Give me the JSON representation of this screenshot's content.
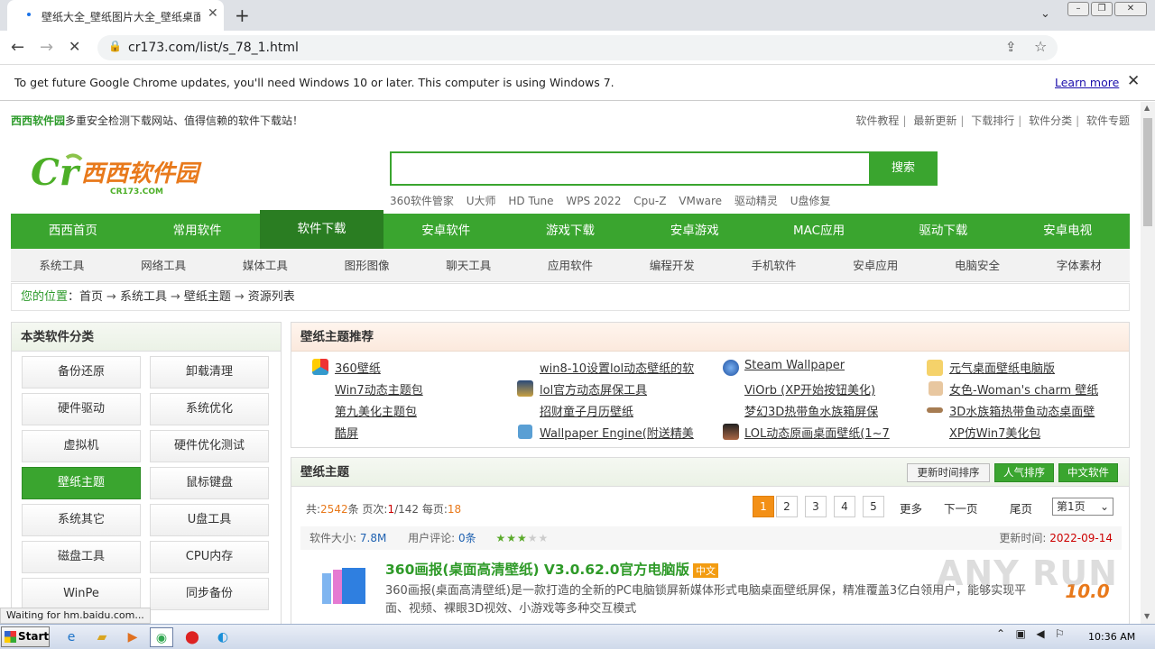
{
  "browser": {
    "tab_title": "壁纸大全_壁纸图片大全_壁纸桌面下载",
    "url": "cr173.com/list/s_78_1.html",
    "infobar_message": "To get future Google Chrome updates, you'll need Windows 10 or later. This computer is using Windows 7.",
    "infobar_link": "Learn more",
    "status_text": "Waiting for hm.baidu.com..."
  },
  "site": {
    "brand": "西西软件园",
    "tagline": "多重安全检测下载网站、值得信赖的软件下载站！",
    "top_links": [
      "软件教程",
      "最新更新",
      "下载排行",
      "软件分类",
      "软件专题"
    ],
    "logo_text": "西西软件园",
    "logo_sub": "CR173.COM",
    "search_button": "搜索",
    "hot_words": [
      "360软件管家",
      "U大师",
      "HD Tune",
      "WPS 2022",
      "Cpu-Z",
      "VMware",
      "驱动精灵",
      "U盘修复"
    ],
    "main_nav": [
      "西西首页",
      "常用软件",
      "软件下载",
      "安卓软件",
      "游戏下载",
      "安卓游戏",
      "MAC应用",
      "驱动下载",
      "安卓电视"
    ],
    "main_nav_active": "软件下载",
    "sub_nav": [
      "系统工具",
      "网络工具",
      "媒体工具",
      "图形图像",
      "聊天工具",
      "应用软件",
      "编程开发",
      "手机软件",
      "安卓应用",
      "电脑安全",
      "字体素材"
    ],
    "breadcrumb": {
      "label": "您的位置",
      "items": [
        "首页",
        "系统工具",
        "壁纸主题",
        "资源列表"
      ]
    }
  },
  "categories": {
    "title": "本类软件分类",
    "items": [
      "备份还原",
      "卸载清理",
      "硬件驱动",
      "系统优化",
      "虚拟机",
      "硬件优化测试",
      "壁纸主题",
      "鼠标键盘",
      "系统其它",
      "U盘工具",
      "磁盘工具",
      "CPU内存",
      "WinPe",
      "同步备份"
    ],
    "active": "壁纸主题"
  },
  "recommend": {
    "title": "壁纸主题推荐",
    "col1": [
      "360壁纸",
      "Win7动态主题包",
      "第九美化主题包",
      "酷屏"
    ],
    "col2": [
      "win8-10设置lol动态壁纸的软",
      "lol官方动态屏保工具",
      "招财童子月历壁纸",
      "Wallpaper Engine(附送精美"
    ],
    "col3": [
      "Steam Wallpaper",
      "ViOrb (XP开始按钮美化)",
      "梦幻3D热带鱼水族箱屏保",
      "LOL动态原画桌面壁纸(1~7"
    ],
    "col4": [
      "元气桌面壁纸电脑版",
      "女色-Woman's charm 壁纸",
      "3D水族箱热带鱼动态桌面壁",
      "XP仿Win7美化包"
    ]
  },
  "listing": {
    "title": "壁纸主题",
    "sort_buttons": [
      "更新时间排序",
      "人气排序",
      "中文软件"
    ],
    "total_prefix": "共:",
    "total": "2542",
    "total_suffix": "条 页次:",
    "page_cur": "1",
    "page_sep": "/142 每页:",
    "per_page": "18",
    "pages": [
      "1",
      "2",
      "3",
      "4",
      "5"
    ],
    "more": "更多",
    "next": "下一页",
    "last": "尾页",
    "page_select": "第1页",
    "item": {
      "size_label": "软件大小:",
      "size": "7.8M",
      "comment_label": "用户评论:",
      "comments": "0条",
      "rating": 3,
      "update_label": "更新时间:",
      "update": "2022-09-14",
      "title": "360画报(桌面高清壁纸) V3.0.62.0官方电脑版",
      "lang_badge": "中文",
      "desc": "360画报(桌面高清壁纸)是一款打造的全新的PC电脑锁屏新媒体形式电脑桌面壁纸屏保，精准覆盖3亿白领用户，能够实现平面、视频、裸眼3D视效、小游戏等多种交互模式",
      "score": "10.0"
    }
  },
  "watermark": "ANY RUN",
  "taskbar": {
    "start": "Start",
    "clock": "10:36 AM"
  }
}
